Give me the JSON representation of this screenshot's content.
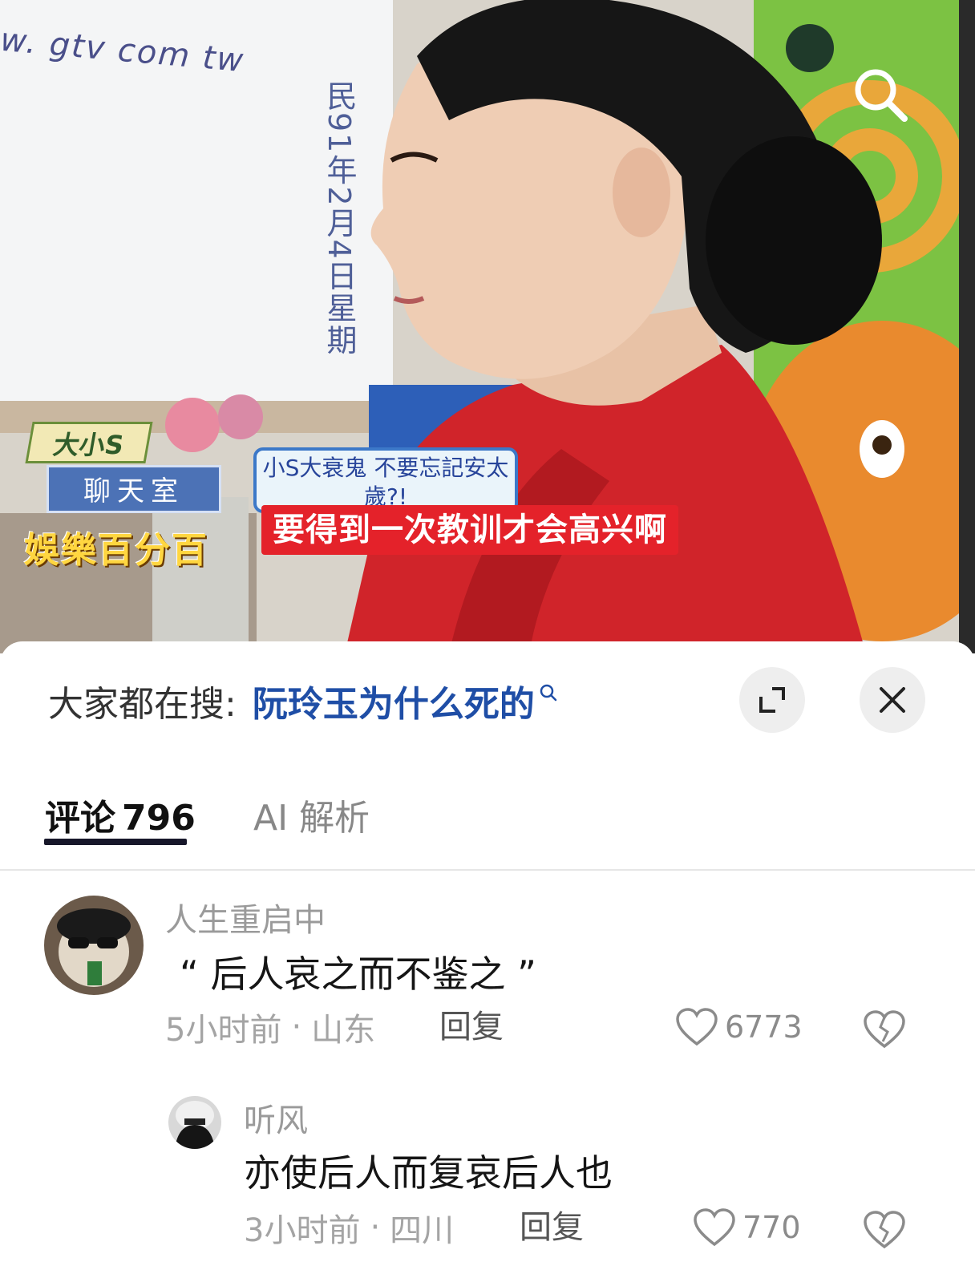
{
  "video": {
    "site_url": "w. gtv com tw",
    "board_date": "民91年2月4日星期",
    "show_label_1": "大小S",
    "show_label_2": "聊天室",
    "show_logo": "娛樂百分百",
    "topic_text": "小S大衰鬼 不要忘記安太歲?!",
    "subtitle": "要得到一次教训才会高兴啊"
  },
  "trending": {
    "prefix": "大家都在搜:",
    "query": "阮玲玉为什么死的"
  },
  "tabs": [
    {
      "label": "评论",
      "count": "796",
      "active": true
    },
    {
      "label": "AI 解析",
      "active": false
    }
  ],
  "comments": [
    {
      "username": "人生重启中",
      "text": "“ 后人哀之而不鉴之 ”",
      "time": "5小时前",
      "location": "山东",
      "reply_label": "回复",
      "likes": "6773"
    },
    {
      "username": "听风",
      "text": "亦使后人而复哀后人也",
      "time": "3小时前",
      "location": "四川",
      "reply_label": "回复",
      "likes": "770"
    }
  ],
  "colors": {
    "accent_query": "#1f4ea6",
    "subtitle_bg": "#e4222a",
    "tab_underline": "#17172a"
  }
}
